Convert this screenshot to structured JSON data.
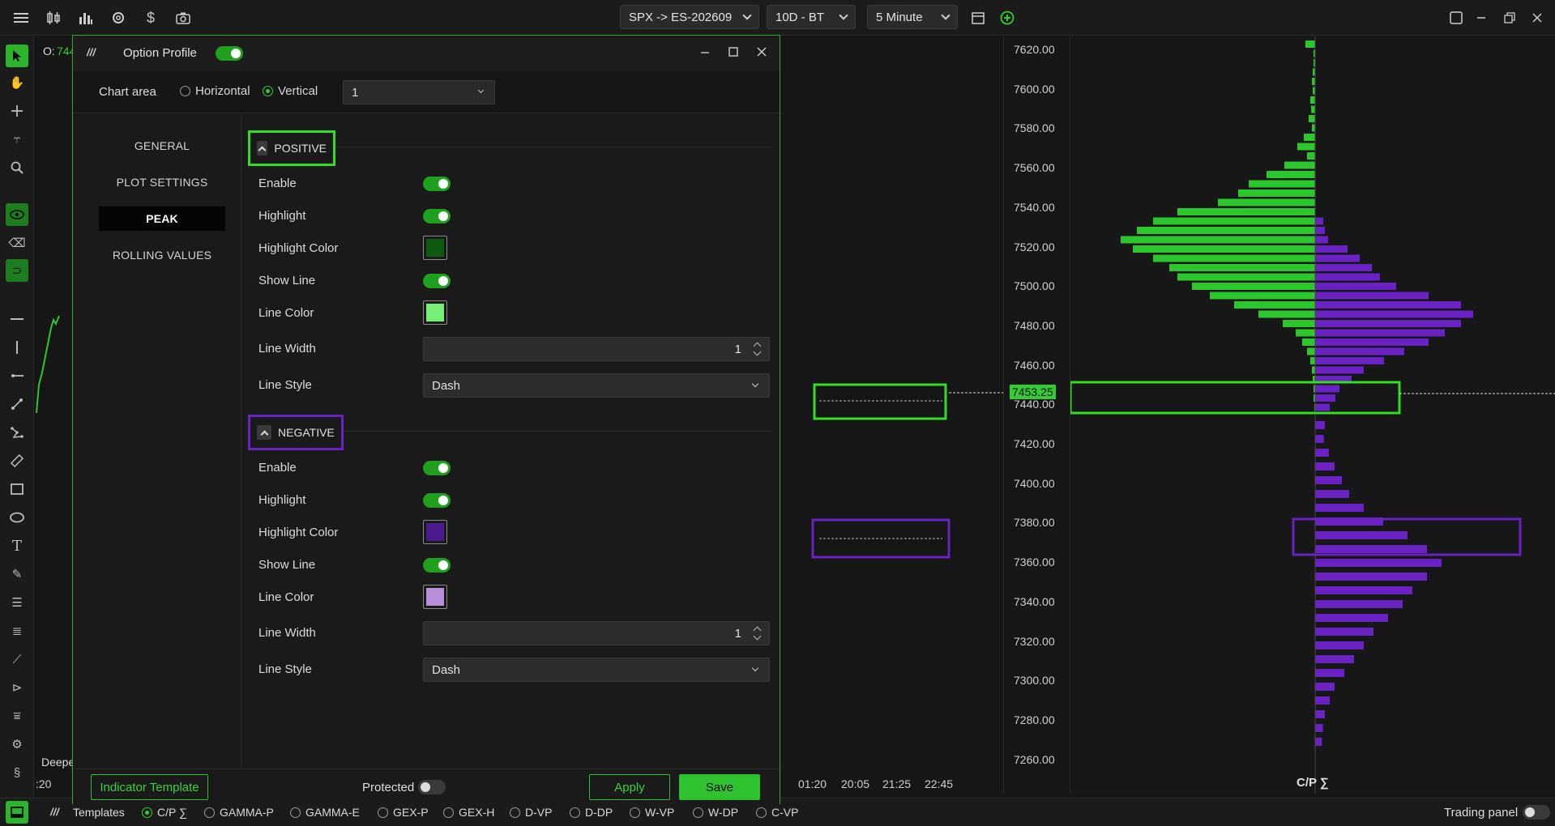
{
  "toolbar": {
    "symbol": "SPX -> ES-202609",
    "range": "10D - BT",
    "interval": "5 Minute"
  },
  "chart": {
    "open_label": "O:",
    "open_value": "744",
    "left_time_fragment": ":20",
    "time_labels": [
      "01:20",
      "20:05",
      "21:25",
      "22:45"
    ],
    "bottom_left_text": "Deepe",
    "price_labels": [
      "7620.00",
      "7600.00",
      "7580.00",
      "7560.00",
      "7540.00",
      "7520.00",
      "7500.00",
      "7480.00",
      "7460.00",
      "7440.00",
      "7420.00",
      "7400.00",
      "7380.00",
      "7360.00",
      "7340.00",
      "7320.00",
      "7300.00",
      "7280.00",
      "7260.00"
    ],
    "current_price": "7453.25",
    "profile_title": "C/P ∑",
    "colors": {
      "positive": "#2cc72c",
      "negative": "#6a22c4"
    }
  },
  "dialog": {
    "title": "Option Profile",
    "chart_area_label": "Chart area",
    "horizontal_label": "Horizontal",
    "vertical_label": "Vertical",
    "area_select_value": "1",
    "nav": [
      "GENERAL",
      "PLOT SETTINGS",
      "PEAK",
      "ROLLING VALUES"
    ],
    "positive": {
      "header": "POSITIVE",
      "enable": "Enable",
      "highlight": "Highlight",
      "highlight_color": "Highlight Color",
      "show_line": "Show Line",
      "line_color": "Line Color",
      "line_width": "Line Width",
      "line_width_value": "1",
      "line_style": "Line Style",
      "line_style_value": "Dash",
      "highlight_color_hex": "#0e5a12",
      "line_color_hex": "#77ee77"
    },
    "negative": {
      "header": "NEGATIVE",
      "enable": "Enable",
      "highlight": "Highlight",
      "highlight_color": "Highlight Color",
      "show_line": "Show Line",
      "line_color": "Line Color",
      "line_width": "Line Width",
      "line_width_value": "1",
      "line_style": "Line Style",
      "line_style_value": "Dash",
      "highlight_color_hex": "#4b1a8c",
      "line_color_hex": "#b98fdb"
    },
    "footer": {
      "template_button": "Indicator Template",
      "protected_label": "Protected",
      "apply_button": "Apply",
      "save_button": "Save"
    }
  },
  "bottombar": {
    "templates_label": "Templates",
    "tabs": [
      "C/P ∑",
      "GAMMA-P",
      "GAMMA-E",
      "GEX-P",
      "GEX-H",
      "D-VP",
      "D-DP",
      "W-VP",
      "W-DP",
      "C-VP"
    ],
    "trading_panel_label": "Trading panel"
  }
}
